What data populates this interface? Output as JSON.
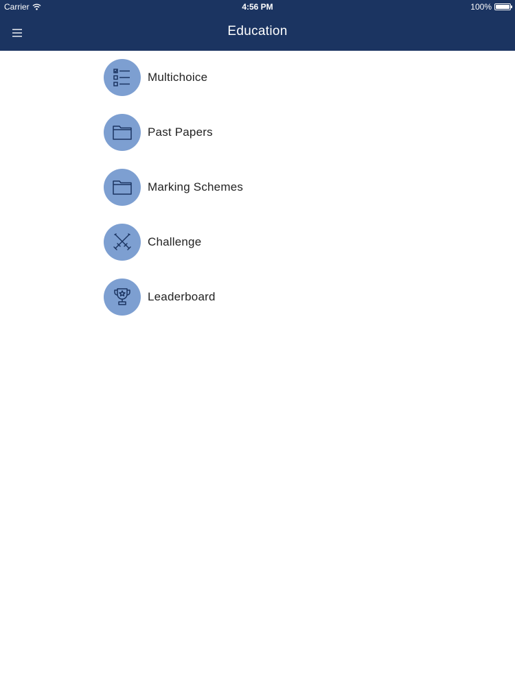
{
  "status_bar": {
    "carrier": "Carrier",
    "time": "4:56 PM",
    "battery": "100%",
    "battery_level": 1.0
  },
  "nav": {
    "title": "Education",
    "menu_icon": "hamburger-menu-icon"
  },
  "colors": {
    "nav_background": "#1b3461",
    "icon_circle": "#7d9fd1",
    "icon_stroke": "#1b3461",
    "label_text": "#222222"
  },
  "menu": {
    "items": [
      {
        "label": "Multichoice",
        "icon": "checklist-icon"
      },
      {
        "label": "Past Papers",
        "icon": "folder-icon"
      },
      {
        "label": "Marking Schemes",
        "icon": "folder-icon"
      },
      {
        "label": "Challenge",
        "icon": "crossed-swords-icon"
      },
      {
        "label": "Leaderboard",
        "icon": "trophy-icon"
      }
    ]
  }
}
